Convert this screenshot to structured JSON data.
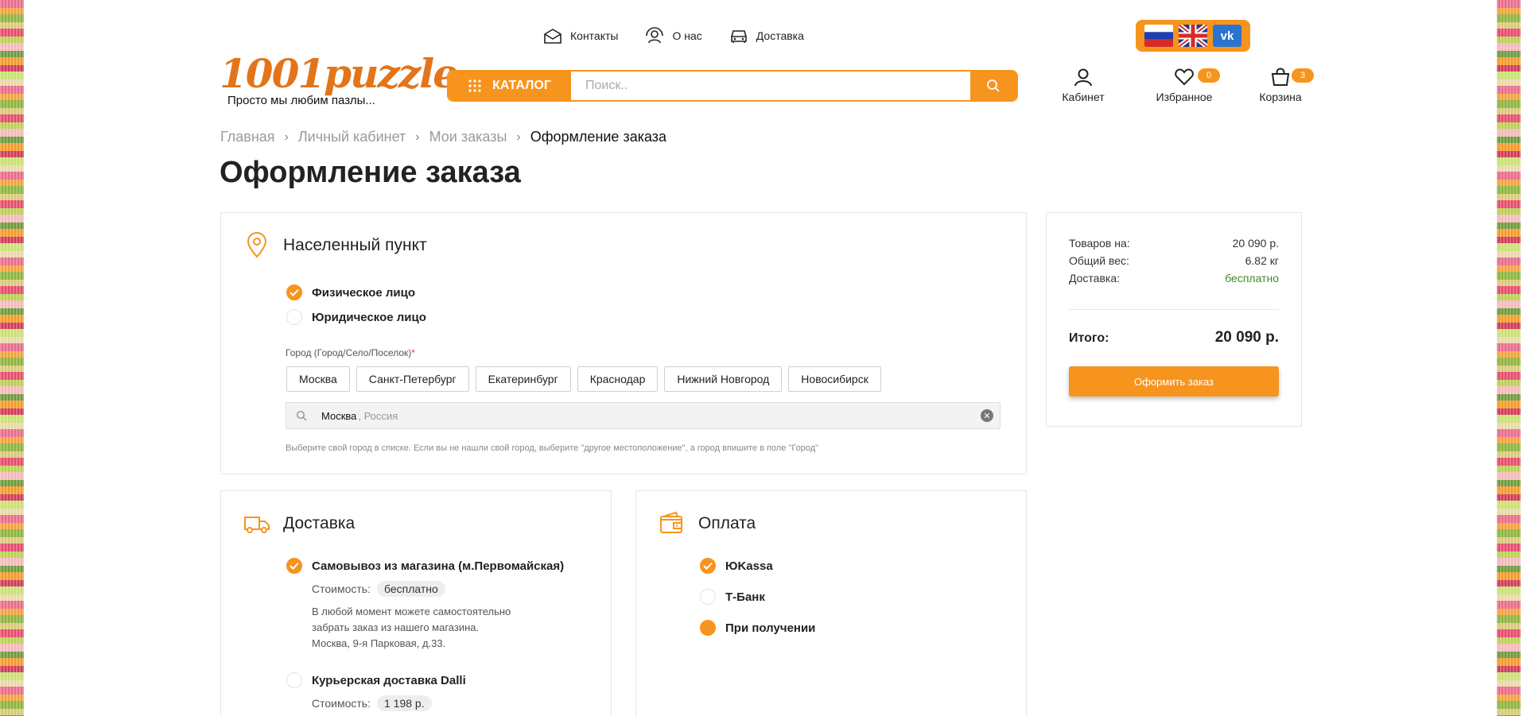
{
  "topnav": [
    {
      "label": "Контакты",
      "icon": "mail-icon"
    },
    {
      "label": "О нас",
      "icon": "people-icon"
    },
    {
      "label": "Доставка",
      "icon": "car-icon"
    }
  ],
  "logo": {
    "text": "1001puzzle",
    "slogan": "Просто мы любим пазлы..."
  },
  "search": {
    "catalog_label": "КАТАЛОГ",
    "placeholder": "Поиск.."
  },
  "user_actions": {
    "cabinet": {
      "label": "Кабинет"
    },
    "favorites": {
      "label": "Избранное",
      "count": "0"
    },
    "cart": {
      "label": "Корзина",
      "count": "3"
    }
  },
  "breadcrumb": [
    "Главная",
    "Личный кабинет",
    "Мои заказы",
    "Оформление заказа"
  ],
  "page_title": "Оформление заказа",
  "locality": {
    "title": "Населенный пункт",
    "person_types": [
      {
        "label": "Физическое лицо",
        "selected": true
      },
      {
        "label": "Юридическое лицо",
        "selected": false
      }
    ],
    "city_label": "Город (Город/Село/Поселок)",
    "required_mark": "*",
    "cities": [
      "Москва",
      "Санкт-Петербург",
      "Екатеринбург",
      "Краснодар",
      "Нижний Новгород",
      "Новосибирск"
    ],
    "city_value": "Москва",
    "city_country": ", Россия",
    "hint": "Выберите свой город в списке. Если вы не нашли свой город, выберите \"другое местоположение\", а город впишите в поле \"Город\""
  },
  "summary": {
    "goods_label": "Товаров на:",
    "goods_value": "20 090 р.",
    "weight_label": "Общий вес:",
    "weight_value": "6.82 кг",
    "delivery_label": "Доставка:",
    "delivery_value": "бесплатно",
    "total_label": "Итого:",
    "total_value": "20 090 р.",
    "order_button": "Оформить заказ"
  },
  "delivery": {
    "title": "Доставка",
    "options": [
      {
        "label": "Самовывоз из магазина (м.Первомайская)",
        "cost_label": "Стоимость:",
        "cost": "бесплатно",
        "desc": [
          "В любой момент можете самостоятельно",
          "забрать заказ из нашего магазина.",
          "Москва, 9-я Парковая, д.33."
        ],
        "selected": true
      },
      {
        "label": "Курьерская доставка Dalli",
        "cost_label": "Стоимость:",
        "cost": "1 198 р.",
        "selected": false
      }
    ]
  },
  "payment": {
    "title": "Оплата",
    "options": [
      {
        "label": "ЮKassa",
        "state": "checked"
      },
      {
        "label": "Т-Банк",
        "state": "empty"
      },
      {
        "label": "При получении",
        "state": "dot"
      }
    ]
  },
  "colors": {
    "accent": "#f7941d",
    "text": "#222222",
    "muted": "#9a9a9a",
    "free": "#3f8a2a"
  }
}
